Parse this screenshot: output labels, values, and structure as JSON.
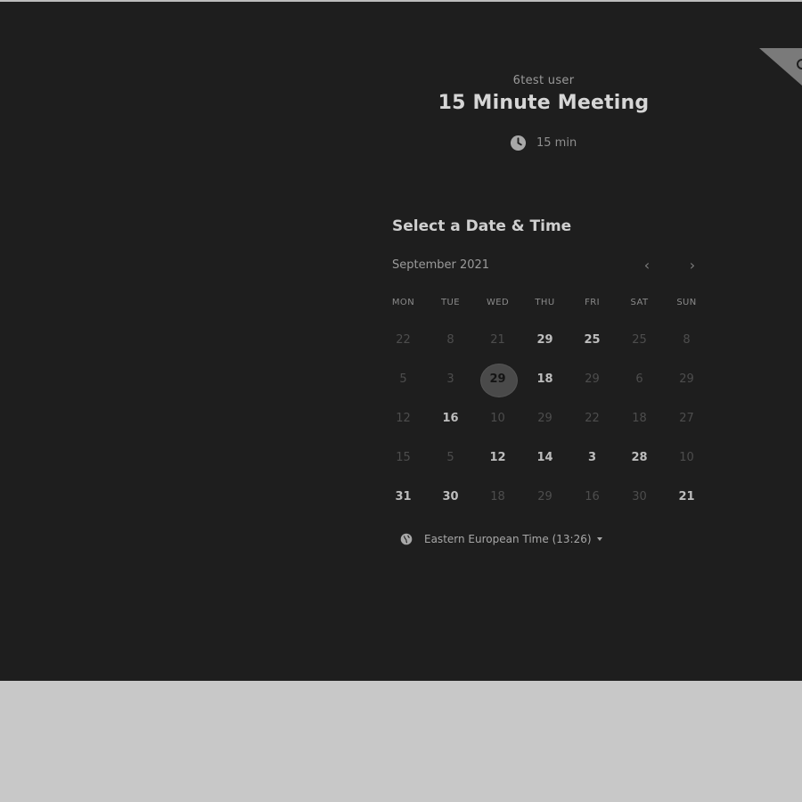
{
  "header": {
    "user_name": "6test user",
    "event_title": "15 Minute Meeting",
    "duration": "15 min"
  },
  "picker": {
    "heading": "Select a Date & Time",
    "month_label": "September 2021",
    "prev_label": "‹",
    "next_label": "›",
    "weekdays": [
      "MON",
      "TUE",
      "WED",
      "THU",
      "FRI",
      "SAT",
      "SUN"
    ],
    "weeks": [
      [
        {
          "n": "22",
          "a": false
        },
        {
          "n": "8",
          "a": false
        },
        {
          "n": "21",
          "a": false
        },
        {
          "n": "29",
          "a": true
        },
        {
          "n": "25",
          "a": true
        },
        {
          "n": "25",
          "a": false
        },
        {
          "n": "8",
          "a": false
        }
      ],
      [
        {
          "n": "5",
          "a": false
        },
        {
          "n": "3",
          "a": false
        },
        {
          "n": "29",
          "a": true,
          "sel": true
        },
        {
          "n": "18",
          "a": true
        },
        {
          "n": "29",
          "a": false
        },
        {
          "n": "6",
          "a": false
        },
        {
          "n": "29",
          "a": false
        }
      ],
      [
        {
          "n": "12",
          "a": false
        },
        {
          "n": "16",
          "a": true
        },
        {
          "n": "10",
          "a": false
        },
        {
          "n": "29",
          "a": false
        },
        {
          "n": "22",
          "a": false
        },
        {
          "n": "18",
          "a": false
        },
        {
          "n": "27",
          "a": false
        }
      ],
      [
        {
          "n": "15",
          "a": false
        },
        {
          "n": "5",
          "a": false
        },
        {
          "n": "12",
          "a": true
        },
        {
          "n": "14",
          "a": true
        },
        {
          "n": "3",
          "a": true
        },
        {
          "n": "28",
          "a": true
        },
        {
          "n": "10",
          "a": false
        }
      ],
      [
        {
          "n": "31",
          "a": true
        },
        {
          "n": "30",
          "a": true
        },
        {
          "n": "18",
          "a": false
        },
        {
          "n": "29",
          "a": false
        },
        {
          "n": "16",
          "a": false
        },
        {
          "n": "30",
          "a": false
        },
        {
          "n": "21",
          "a": true
        }
      ]
    ]
  },
  "timezone": {
    "label": "Eastern European Time (13:26)"
  },
  "icons": {
    "duration": "clock-icon",
    "timezone": "globe-icon",
    "prev": "chevron-left-icon",
    "next": "chevron-right-icon"
  }
}
